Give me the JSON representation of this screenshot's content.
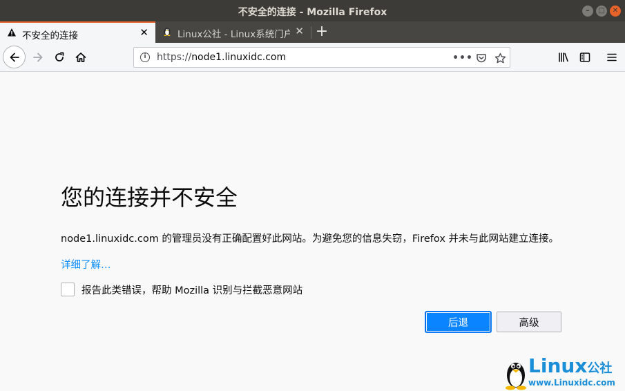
{
  "window": {
    "title": "不安全的连接 - Mozilla Firefox"
  },
  "tabs": [
    {
      "label": "不安全的连接",
      "icon": "warning-icon",
      "active": true
    },
    {
      "label": "Linux公社 - Linux系统门户",
      "icon": "penguin-icon",
      "active": false
    }
  ],
  "urlbar": {
    "scheme": "https://",
    "host": "node1.linuxidc.com"
  },
  "error": {
    "title": "您的连接并不安全",
    "description": "node1.linuxidc.com 的管理员没有正确配置好此网站。为避免您的信息失窃，Firefox 并未与此网站建立连接。",
    "learn_more": "详细了解…",
    "report_label": "报告此类错误，帮助 Mozilla 识别与拦截恶意网站",
    "back_button": "后退",
    "advanced_button": "高级"
  },
  "watermark": {
    "brand": "Linux",
    "brand_suffix": "公社",
    "site": "www.Linuxidc.com"
  },
  "colors": {
    "titlebar": "#3c3b37",
    "accent_tab": "#e7632a",
    "primary_button": "#0a84ff",
    "link": "#0a8dff",
    "watermark": "#1a8fd8"
  }
}
